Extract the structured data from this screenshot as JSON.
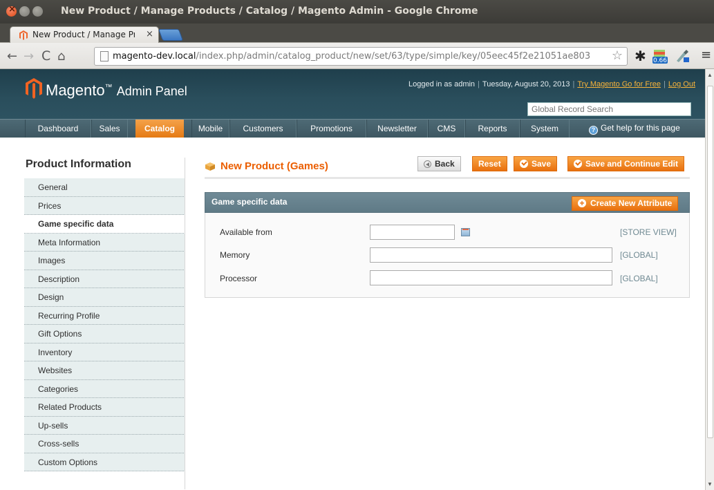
{
  "window": {
    "title": "New Product / Manage Products / Catalog / Magento Admin - Google Chrome"
  },
  "browser": {
    "tab_label": "New Product / Manage Pr",
    "tab_close": "×",
    "url_host": "magento-dev.local",
    "url_path": "/index.php/admin/catalog_product/new/set/63/type/simple/key/05eec45f2e21051ae803",
    "ext_badge": "0.66"
  },
  "header": {
    "logo": "Magento",
    "logo_sub": "Admin Panel",
    "logged_in": "Logged in as admin",
    "date": "Tuesday, August 20, 2013",
    "try_link": "Try Magento Go for Free",
    "logout": "Log Out",
    "search_placeholder": "Global Record Search"
  },
  "nav": {
    "items": [
      "Dashboard",
      "Sales",
      "Catalog",
      "Mobile",
      "Customers",
      "Promotions",
      "Newsletter",
      "CMS",
      "Reports",
      "System"
    ],
    "active": "Catalog",
    "help": "Get help for this page"
  },
  "sidebar": {
    "title": "Product Information",
    "items": [
      "General",
      "Prices",
      "Game specific data",
      "Meta Information",
      "Images",
      "Description",
      "Design",
      "Recurring Profile",
      "Gift Options",
      "Inventory",
      "Websites",
      "Categories",
      "Related Products",
      "Up-sells",
      "Cross-sells",
      "Custom Options"
    ],
    "active": "Game specific data"
  },
  "content": {
    "title": "New Product (Games)",
    "buttons": {
      "back": "Back",
      "reset": "Reset",
      "save": "Save",
      "save_continue": "Save and Continue Edit"
    },
    "section": {
      "title": "Game specific data",
      "create_attribute": "Create New Attribute"
    },
    "fields": [
      {
        "label": "Available from",
        "value": "",
        "scope": "[STORE VIEW]"
      },
      {
        "label": "Memory",
        "value": "",
        "scope": "[GLOBAL]"
      },
      {
        "label": "Processor",
        "value": "",
        "scope": "[GLOBAL]"
      }
    ]
  },
  "colors": {
    "accent": "#eb5e00",
    "header_bg": "#2a4e5c",
    "button": "#e8700f"
  }
}
